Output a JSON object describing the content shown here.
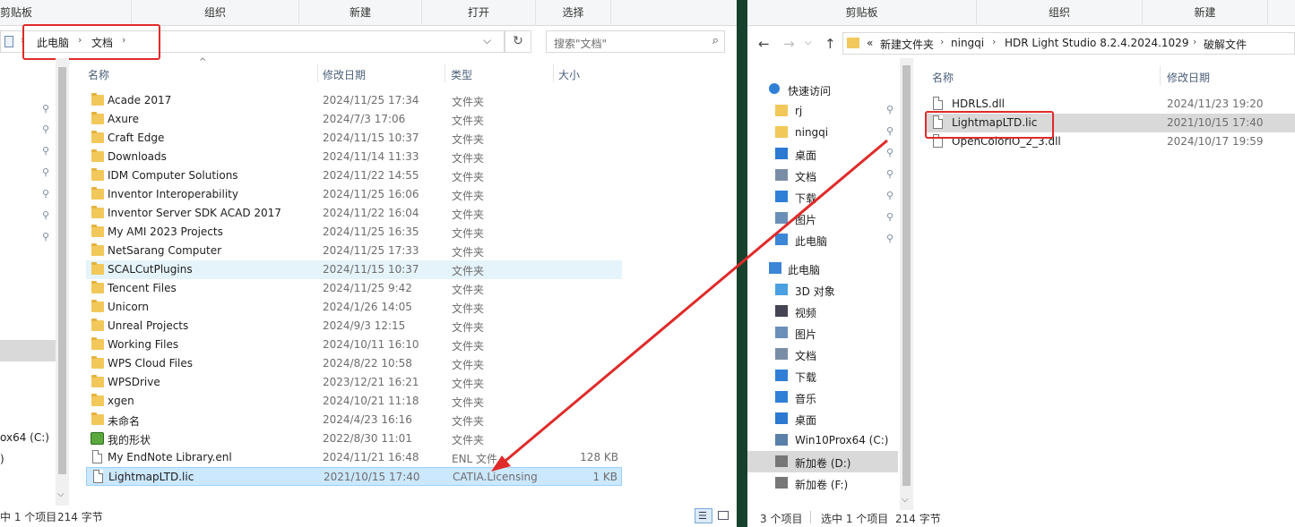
{
  "left": {
    "ribbon": [
      "剪贴板",
      "组织",
      "新建",
      "打开",
      "选择"
    ],
    "breadcrumb": [
      "此电脑",
      "文档"
    ],
    "search_placeholder": "搜索\"文档\"",
    "columns": {
      "name": "名称",
      "date": "修改日期",
      "type": "类型",
      "size": "大小"
    },
    "files": [
      {
        "name": "Acade 2017",
        "date": "2024/11/25 17:34",
        "type": "文件夹",
        "size": "",
        "icon": "folder-icon"
      },
      {
        "name": "Axure",
        "date": "2024/7/3 17:06",
        "type": "文件夹",
        "size": "",
        "icon": "folder-icon"
      },
      {
        "name": "Craft Edge",
        "date": "2024/11/15 10:37",
        "type": "文件夹",
        "size": "",
        "icon": "folder-icon"
      },
      {
        "name": "Downloads",
        "date": "2024/11/14 11:33",
        "type": "文件夹",
        "size": "",
        "icon": "folder-icon"
      },
      {
        "name": "IDM Computer Solutions",
        "date": "2024/11/22 14:55",
        "type": "文件夹",
        "size": "",
        "icon": "folder-icon"
      },
      {
        "name": "Inventor Interoperability",
        "date": "2024/11/25 16:06",
        "type": "文件夹",
        "size": "",
        "icon": "folder-icon"
      },
      {
        "name": "Inventor Server SDK ACAD 2017",
        "date": "2024/11/22 16:04",
        "type": "文件夹",
        "size": "",
        "icon": "folder-icon"
      },
      {
        "name": "My AMI 2023 Projects",
        "date": "2024/11/25 16:35",
        "type": "文件夹",
        "size": "",
        "icon": "folder-icon"
      },
      {
        "name": "NetSarang Computer",
        "date": "2024/11/25 17:33",
        "type": "文件夹",
        "size": "",
        "icon": "folder-icon"
      },
      {
        "name": "SCALCutPlugins",
        "date": "2024/11/15 10:37",
        "type": "文件夹",
        "size": "",
        "icon": "folder-icon"
      },
      {
        "name": "Tencent Files",
        "date": "2024/11/25 9:42",
        "type": "文件夹",
        "size": "",
        "icon": "folder-icon"
      },
      {
        "name": "Unicorn",
        "date": "2024/1/26 14:05",
        "type": "文件夹",
        "size": "",
        "icon": "folder-icon"
      },
      {
        "name": "Unreal Projects",
        "date": "2024/9/3 12:15",
        "type": "文件夹",
        "size": "",
        "icon": "folder-icon"
      },
      {
        "name": "Working Files",
        "date": "2024/10/11 16:10",
        "type": "文件夹",
        "size": "",
        "icon": "folder-icon"
      },
      {
        "name": "WPS Cloud Files",
        "date": "2024/8/22 10:58",
        "type": "文件夹",
        "size": "",
        "icon": "folder-icon"
      },
      {
        "name": "WPSDrive",
        "date": "2023/12/21 16:21",
        "type": "文件夹",
        "size": "",
        "icon": "folder-icon"
      },
      {
        "name": "xgen",
        "date": "2024/10/21 11:18",
        "type": "文件夹",
        "size": "",
        "icon": "folder-icon"
      },
      {
        "name": "未命名",
        "date": "2024/4/23 16:16",
        "type": "文件夹",
        "size": "",
        "icon": "folder-icon"
      },
      {
        "name": "我的形状",
        "date": "2022/8/30 11:01",
        "type": "文件夹",
        "size": "",
        "icon": "shapes-folder-icon"
      },
      {
        "name": "My EndNote Library.enl",
        "date": "2024/11/21 16:48",
        "type": "ENL 文件",
        "size": "128 KB",
        "icon": "file-icon"
      },
      {
        "name": "LightmapLTD.lic",
        "date": "2021/10/15 17:40",
        "type": "CATIA.Licensing",
        "size": "1 KB",
        "icon": "file-icon"
      }
    ],
    "nav_partial": [
      "ox64 (C:)",
      ")"
    ],
    "status": {
      "selected": "中 1 个项目",
      "size": "214 字节"
    }
  },
  "right": {
    "ribbon": [
      "剪贴板",
      "组织",
      "新建"
    ],
    "breadcrumb": [
      "«",
      "新建文件夹",
      "ningqi",
      "HDR Light Studio 8.2.4.2024.1029",
      "破解文件"
    ],
    "columns": {
      "name": "名称",
      "date": "修改日期"
    },
    "files": [
      {
        "name": "HDRLS.dll",
        "date": "2024/11/23 19:20"
      },
      {
        "name": "LightmapLTD.lic",
        "date": "2021/10/15 17:40"
      },
      {
        "name": "OpenColorIO_2_3.dll",
        "date": "2024/10/17 19:59"
      }
    ],
    "nav": [
      {
        "label": "快速访问",
        "icon": "star-icon",
        "indent": 0
      },
      {
        "label": "rj",
        "icon": "folder-icon",
        "indent": 1,
        "pinned": true
      },
      {
        "label": "ningqi",
        "icon": "folder-icon",
        "indent": 1,
        "pinned": true
      },
      {
        "label": "桌面",
        "icon": "desktop-icon",
        "indent": 1,
        "pinned": true
      },
      {
        "label": "文档",
        "icon": "documents-icon",
        "indent": 1,
        "pinned": true
      },
      {
        "label": "下载",
        "icon": "download-icon",
        "indent": 1,
        "pinned": true
      },
      {
        "label": "图片",
        "icon": "pictures-icon",
        "indent": 1,
        "pinned": true
      },
      {
        "label": "此电脑",
        "icon": "computer-icon",
        "indent": 1,
        "pinned": true
      },
      {
        "label": "此电脑",
        "icon": "computer-icon",
        "indent": 0
      },
      {
        "label": "3D 对象",
        "icon": "3d-objects-icon",
        "indent": 1
      },
      {
        "label": "视频",
        "icon": "videos-icon",
        "indent": 1
      },
      {
        "label": "图片",
        "icon": "pictures-icon",
        "indent": 1
      },
      {
        "label": "文档",
        "icon": "documents-icon",
        "indent": 1
      },
      {
        "label": "下载",
        "icon": "download-icon",
        "indent": 1
      },
      {
        "label": "音乐",
        "icon": "music-icon",
        "indent": 1
      },
      {
        "label": "桌面",
        "icon": "desktop-icon",
        "indent": 1
      },
      {
        "label": "Win10Prox64 (C:)",
        "icon": "drive-c-icon",
        "indent": 1
      },
      {
        "label": "新加卷 (D:)",
        "icon": "drive-icon",
        "indent": 1,
        "selected": true
      },
      {
        "label": "新加卷 (F:)",
        "icon": "drive-icon",
        "indent": 1
      }
    ],
    "status": {
      "count": "3 个项目",
      "selected": "选中 1 个项目",
      "size": "214 字节"
    }
  },
  "colors": {
    "annotation_red": "#e02a2a",
    "divider_green": "#17412c",
    "selection": "#cce8ff",
    "hover": "#e5f3fb"
  }
}
